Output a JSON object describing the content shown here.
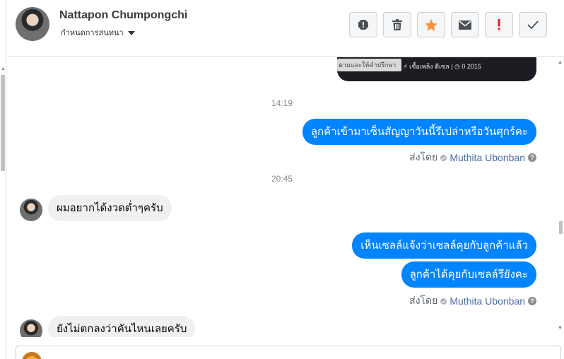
{
  "header": {
    "name": "Nattapon Chumpongchi",
    "subtitle": "กำหนดการสนทนา"
  },
  "actions": [
    {
      "name": "alert-icon",
      "color": "#4b4f56"
    },
    {
      "name": "trash-icon",
      "color": "#4b4f56"
    },
    {
      "name": "star-icon",
      "color": "#f7923a"
    },
    {
      "name": "mail-icon",
      "color": "#4b4f56"
    },
    {
      "name": "exclamation-icon",
      "color": "#e02424"
    },
    {
      "name": "check-icon",
      "color": "#4b4f56"
    }
  ],
  "image_card": {
    "strip_text": "ธรรมดา  |  ⚡ เชื้อเพลิง ดีเซล  |  ◷ 0 2015",
    "overlay_text": "ตามและให้คำปรึกษา"
  },
  "thread": {
    "time1": "14:19",
    "msg1": "ลูกค้าเข้ามาเซ็นสัญญาวันนี้รึเปล่าหรือวันศุกร์คะ",
    "sent_by_label": "ส่งโดย",
    "sent_by_name": "Muthita Ubonban",
    "time2": "20:45",
    "msg2": "ผมอยากได้งวดต่ำๆครับ",
    "msg3": "เห็นเซลล์แจ้งว่าเซลล์คุยกับลูกค้าแล้ว",
    "msg4": "ลูกค้าได้คุยกับเซลล์รึยังคะ",
    "msg5": "ยังไม่ตกลงว่าคันไหนเลยครับ"
  },
  "colors": {
    "accent": "#0084ff",
    "incoming_bubble": "#f0f0f0",
    "star": "#f7923a",
    "danger": "#e02424"
  }
}
